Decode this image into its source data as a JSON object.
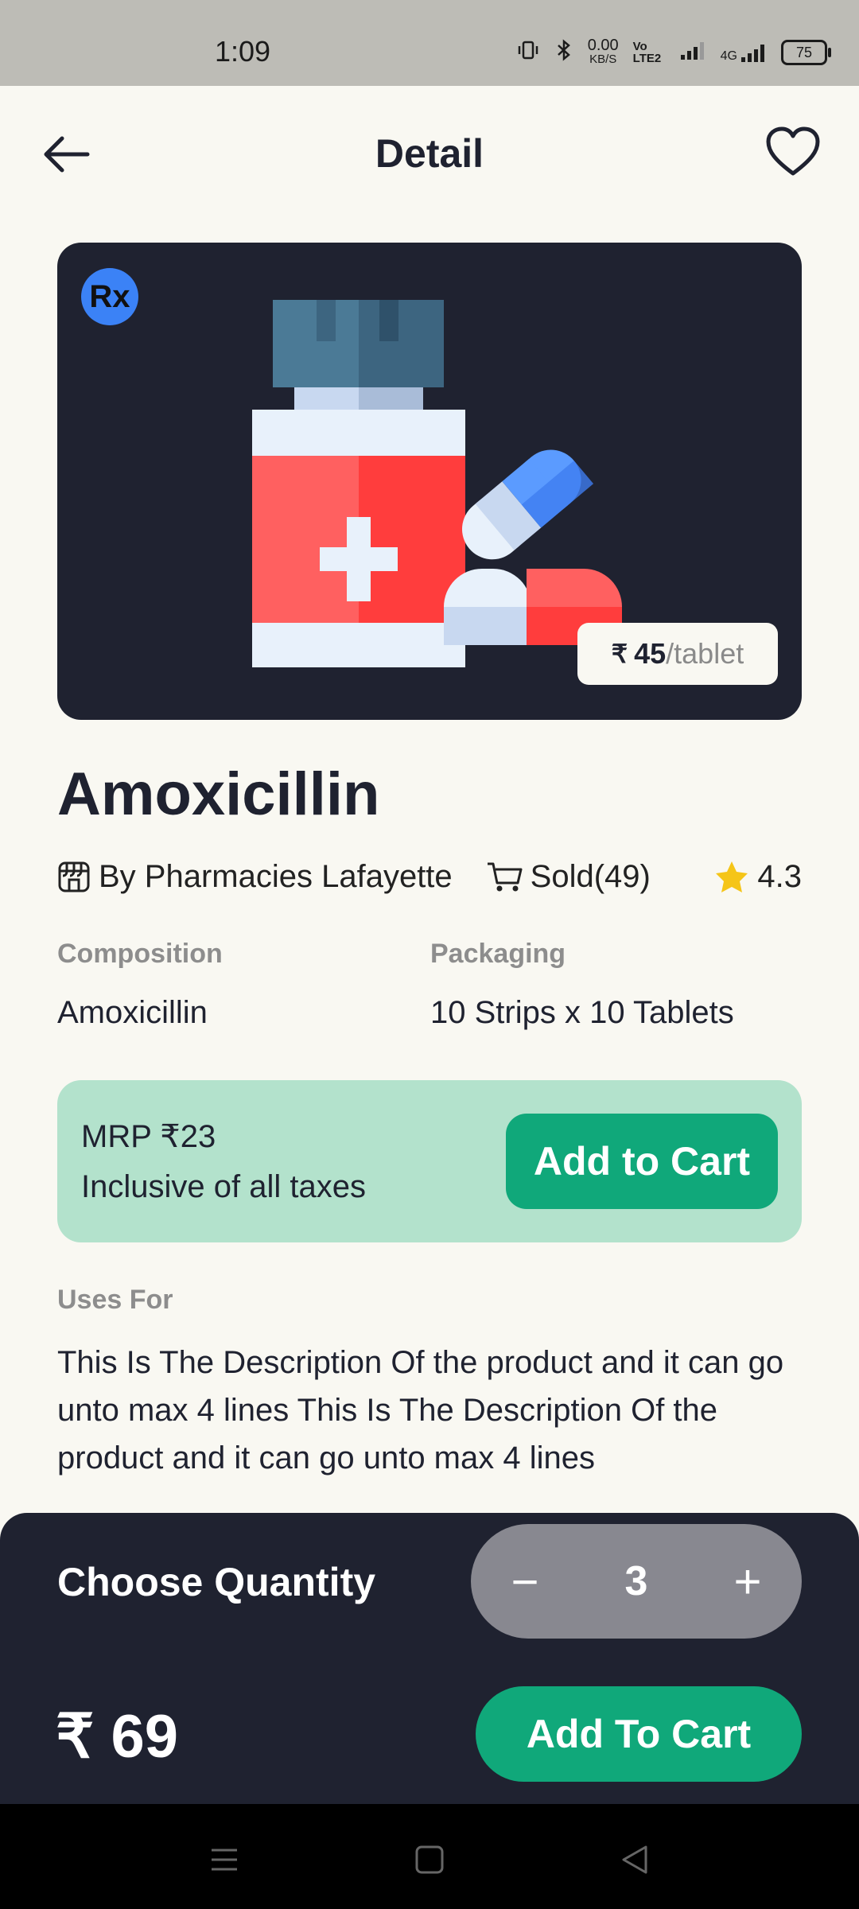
{
  "status_bar": {
    "time": "1:09",
    "net_speed_value": "0.00",
    "net_speed_unit": "KB/S",
    "volte": "Vo LTE2",
    "network": "4G",
    "battery": "75"
  },
  "header": {
    "title": "Detail"
  },
  "product": {
    "rx_badge": "Rx",
    "price_symbol": "₹",
    "price": "45",
    "price_unit": "/tablet",
    "name": "Amoxicillin",
    "seller": "By Pharmacies Lafayette",
    "sold": "Sold(49)",
    "rating": "4.3"
  },
  "info": {
    "composition_label": "Composition",
    "composition_value": "Amoxicillin",
    "packaging_label": "Packaging",
    "packaging_value": "10 Strips x 10 Tablets"
  },
  "mrp": {
    "line1": "MRP ₹23",
    "line2": "Inclusive of all taxes",
    "button": "Add to Cart"
  },
  "uses": {
    "label": "Uses For",
    "text": "This Is The Description Of the product and it can go unto max 4 lines This Is The Description Of the product and it can go unto max 4 lines"
  },
  "quantity_panel": {
    "title": "Choose Quantity",
    "minus": "−",
    "quantity": "3",
    "plus": "+",
    "total": "₹ 69",
    "button": "Add To Cart"
  },
  "colors": {
    "accent": "#10a87a",
    "dark": "#1f2230",
    "mrp_bg": "#b3e2cc"
  }
}
